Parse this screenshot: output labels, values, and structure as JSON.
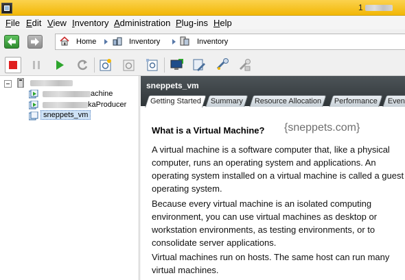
{
  "window": {
    "title_suffix": "1"
  },
  "menu": {
    "items": [
      "File",
      "Edit",
      "View",
      "Inventory",
      "Administration",
      "Plug-ins",
      "Help"
    ]
  },
  "breadcrumb": {
    "items": [
      {
        "label": "Home",
        "icon": "home-icon"
      },
      {
        "label": "Inventory",
        "icon": "inventory-icon"
      },
      {
        "label": "Inventory",
        "icon": "vm-inventory-icon"
      }
    ]
  },
  "toolbar": {
    "buttons": [
      "stop",
      "pause",
      "power-on",
      "reset",
      "snapshot",
      "revert-snapshot",
      "snapshot-manager",
      "console",
      "edit-settings",
      "migrate",
      "clone"
    ]
  },
  "tree": {
    "host_label": "",
    "items": [
      {
        "label_visible": "achine",
        "icon": "vm-running-icon"
      },
      {
        "label_visible": "kaProducer",
        "icon": "vm-running-icon"
      },
      {
        "label_visible": "sneppets_vm",
        "icon": "vm-icon",
        "selected": true
      }
    ]
  },
  "detail": {
    "title": "sneppets_vm",
    "tabs": [
      "Getting Started",
      "Summary",
      "Resource Allocation",
      "Performance",
      "Event"
    ],
    "active_tab": "Getting Started",
    "heading": "What is a Virtual Machine?",
    "watermark": "{sneppets.com}",
    "paragraphs": [
      "A virtual machine is a software computer that, like a physical computer, runs an operating system and applications. An operating system installed on a virtual machine is called a guest operating system.",
      "Because every virtual machine is an isolated computing environment, you can use virtual machines as desktop or workstation environments, as testing environments, or to consolidate server applications.",
      "Virtual machines run on hosts. The same host can run many virtual machines."
    ]
  }
}
